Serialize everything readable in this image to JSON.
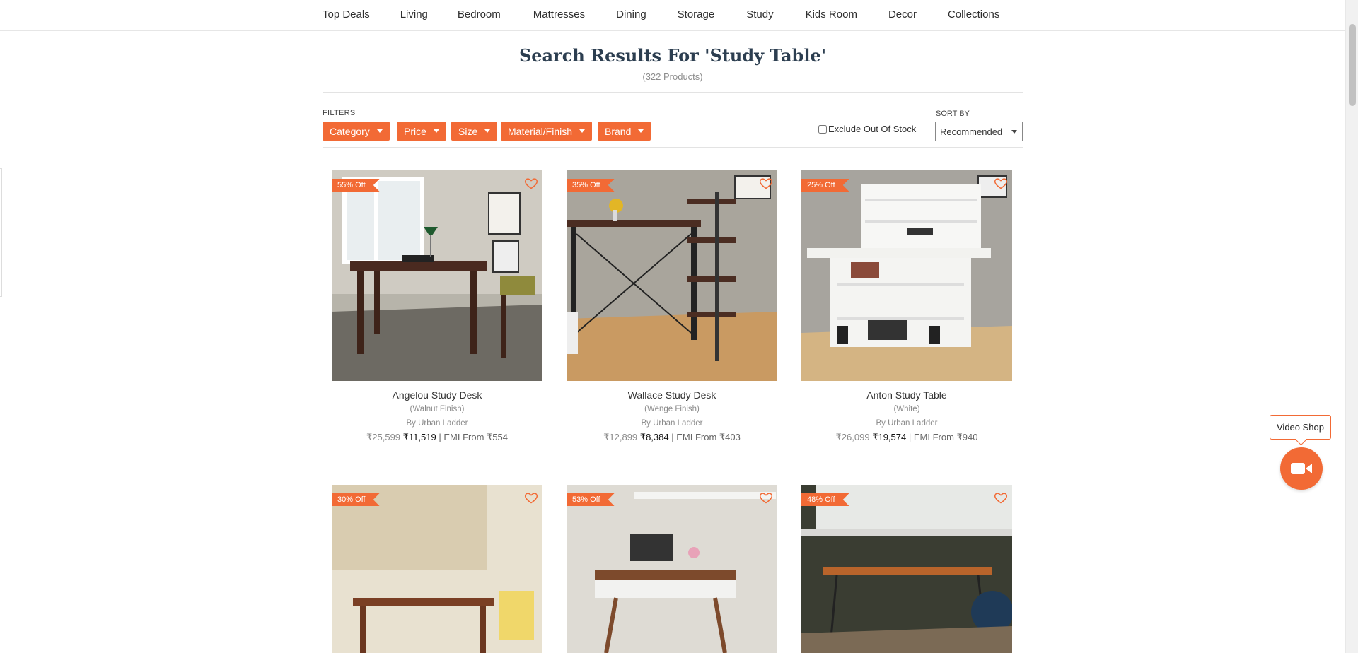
{
  "nav": {
    "items": [
      {
        "label": "Top Deals"
      },
      {
        "label": "Living"
      },
      {
        "label": "Bedroom"
      },
      {
        "label": "Mattresses"
      },
      {
        "label": "Dining"
      },
      {
        "label": "Storage"
      },
      {
        "label": "Study"
      },
      {
        "label": "Kids Room"
      },
      {
        "label": "Decor"
      },
      {
        "label": "Collections"
      }
    ]
  },
  "search": {
    "title": "Search Results For 'Study Table'",
    "count": "(322 Products)"
  },
  "filters": {
    "label": "FILTERS",
    "buttons": [
      "Category",
      "Price",
      "Size",
      "Material/Finish",
      "Brand"
    ],
    "exclude_label": "Exclude Out Of Stock",
    "sort_label": "SORT BY",
    "sort_value": "Recommended"
  },
  "products": [
    {
      "badge": "55% Off",
      "name": "Angelou Study Desk",
      "finish": "(Walnut Finish)",
      "brand": "By Urban Ladder",
      "old_price": "₹25,599",
      "new_price": "₹11,519",
      "emi": "| EMI From ₹554"
    },
    {
      "badge": "35% Off",
      "name": "Wallace Study Desk",
      "finish": "(Wenge Finish)",
      "brand": "By Urban Ladder",
      "old_price": "₹12,899",
      "new_price": "₹8,384",
      "emi": "| EMI From ₹403"
    },
    {
      "badge": "25% Off",
      "name": "Anton Study Table",
      "finish": "(White)",
      "brand": "By Urban Ladder",
      "old_price": "₹26,099",
      "new_price": "₹19,574",
      "emi": "| EMI From ₹940"
    },
    {
      "badge": "30% Off"
    },
    {
      "badge": "53% Off"
    },
    {
      "badge": "48% Off"
    }
  ],
  "video_shop": {
    "label": "Video Shop"
  },
  "colors": {
    "accent": "#f26a35",
    "title": "#2c3e50"
  }
}
